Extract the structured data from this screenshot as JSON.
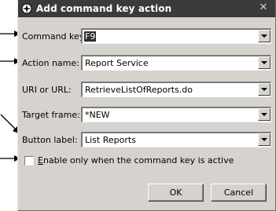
{
  "dialog": {
    "title": "Add command key action",
    "close_glyph": "✕"
  },
  "fields": [
    {
      "label": "Command key:",
      "value": "F9"
    },
    {
      "label": "Action name:",
      "value": "Report Service"
    },
    {
      "label": "URI or URL:",
      "value": "RetrieveListOfReports.do"
    },
    {
      "label": "Target frame:",
      "value": "*NEW"
    },
    {
      "label": "Button label:",
      "value": "List Reports"
    }
  ],
  "checkbox": {
    "mnemonic": "E",
    "label_rest": "nable only when the command key is active",
    "checked": false
  },
  "buttons": {
    "ok": "OK",
    "cancel": "Cancel"
  },
  "icons": {
    "title": "compass-icon",
    "dropdown": "chevron-down-icon",
    "pointer": "callout-arrow-icon"
  },
  "colors": {
    "titlebar": "#3b3b3b",
    "dialog_bg": "#d6d3ce",
    "field_bg": "#ffffff"
  }
}
